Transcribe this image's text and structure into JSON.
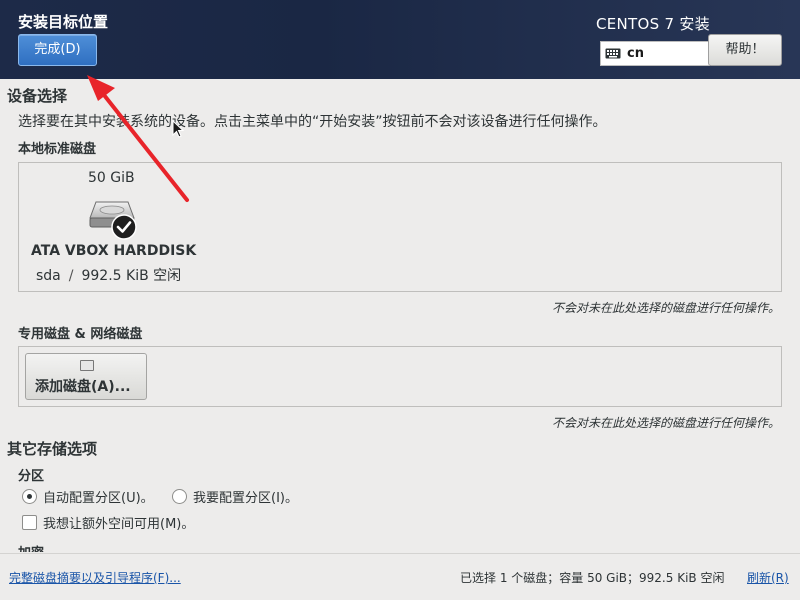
{
  "header": {
    "title": "安装目标位置",
    "done_button": "完成(D)",
    "product": "CENTOS 7 安装",
    "keyboard_layout": "cn",
    "help_button": "帮助！"
  },
  "device_selection": {
    "title": "设备选择",
    "description": "选择要在其中安装系统的设备。点击主菜单中的“开始安装”按钮前不会对该设备进行任何操作。",
    "local_disks_title": "本地标准磁盘",
    "disks": [
      {
        "size": "50 GiB",
        "name": "ATA VBOX HARDDISK",
        "device": "sda",
        "separator": "/",
        "free": "992.5 KiB 空闲",
        "selected": true,
        "icon": "harddisk-icon"
      }
    ],
    "local_note": "不会对未在此处选择的磁盘进行任何操作。",
    "special_title": "专用磁盘 & 网络磁盘",
    "add_disk_button": "添加磁盘(A)...",
    "special_note": "不会对未在此处选择的磁盘进行任何操作。"
  },
  "other_options": {
    "title": "其它存储选项",
    "partition_title": "分区",
    "auto_partition": "自动配置分区(U)。",
    "manual_partition": "我要配置分区(I)。",
    "auto_selected": true,
    "extra_space": "我想让额外空间可用(M)。",
    "extra_space_checked": false,
    "encryption_title": "加密"
  },
  "footer": {
    "summary_link": "完整磁盘摘要以及引导程序(F)...",
    "status": "已选择 1 个磁盘；容量 50 GiB；992.5 KiB 空闲",
    "refresh_link": "刷新(R)"
  },
  "colors": {
    "header_bg": "#1d2a48",
    "primary_button": "#3a7bd5",
    "annotation_arrow": "#e8242a",
    "link": "#1a55a8"
  }
}
